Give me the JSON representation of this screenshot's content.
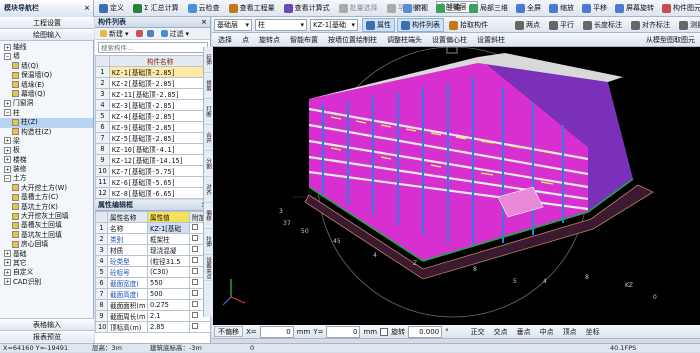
{
  "title_bar": {
    "text": "模块导航栏",
    "close": "×"
  },
  "top_toolbar": {
    "items": [
      {
        "label": "定义",
        "icon": "define-icon",
        "color": "#3c6fb0"
      },
      {
        "label": "Σ 汇总计算",
        "icon": "sum-icon",
        "color": "#2a7f3a"
      },
      {
        "label": "云检查",
        "icon": "cloud-check-icon",
        "color": "#4a90d9"
      },
      {
        "label": "查看工程量",
        "icon": "view-quantity-icon",
        "color": "#c07a1a"
      },
      {
        "label": "查看计算式",
        "icon": "view-formula-icon",
        "color": "#6b4ab0"
      },
      {
        "label": "批量选择",
        "icon": "batch-select-icon",
        "color": "#888888"
      },
      {
        "label": "平齐板顶",
        "icon": "flush-slab-icon",
        "color": "#888888"
      }
    ],
    "floor_select": "全部楼层",
    "right_items": [
      {
        "label": "俯视",
        "icon": "top-view-icon"
      },
      {
        "label": "三维",
        "icon": "3d-icon"
      },
      {
        "label": "局部三维",
        "icon": "local-3d-icon"
      },
      {
        "label": "全屏",
        "icon": "fullscreen-icon"
      },
      {
        "label": "缩放",
        "icon": "zoom-icon"
      },
      {
        "label": "平移",
        "icon": "pan-icon"
      },
      {
        "label": "屏幕旋转",
        "icon": "rotate-screen-icon"
      },
      {
        "label": "构件图元显示设置",
        "icon": "display-settings-icon"
      }
    ]
  },
  "second_toolbar": {
    "layer_select": "基础层",
    "type_select": "柱",
    "name_select": "KZ-1[基础",
    "items": [
      {
        "label": "属性",
        "icon": "property-icon"
      },
      {
        "label": "构件列表",
        "icon": "component-list-icon"
      },
      {
        "label": "拾取构件",
        "icon": "pick-component-icon"
      }
    ],
    "right_items": [
      {
        "label": "两点",
        "icon": "two-point-icon"
      },
      {
        "label": "平行",
        "icon": "parallel-icon"
      },
      {
        "label": "长度标注",
        "icon": "length-dim-icon"
      },
      {
        "label": "对齐标注",
        "icon": "align-dim-icon"
      },
      {
        "label": "测量距离",
        "icon": "measure-icon"
      }
    ]
  },
  "third_toolbar": {
    "items": [
      "选择",
      "点",
      "旋转点",
      "智能布置",
      "按墙位置绘制柱",
      "调整柱端头",
      "设置偏心柱",
      "设置斜柱"
    ],
    "right": "从模型图取图元"
  },
  "nav_panel": {
    "buttons": [
      "工程设置",
      "绘图输入"
    ],
    "tree": [
      {
        "label": "轴线",
        "indent": 1,
        "sign": "+"
      },
      {
        "label": "墙",
        "indent": 1,
        "sign": "−"
      },
      {
        "label": "墙(Q)",
        "indent": 3,
        "sign": ""
      },
      {
        "label": "保温墙(Q)",
        "indent": 3,
        "sign": ""
      },
      {
        "label": "墙垛(E)",
        "indent": 3,
        "sign": ""
      },
      {
        "label": "幕墙(Q)",
        "indent": 3,
        "sign": ""
      },
      {
        "label": "门窗洞",
        "indent": 1,
        "sign": "+"
      },
      {
        "label": "柱",
        "indent": 1,
        "sign": "−"
      },
      {
        "label": "柱(Z)",
        "indent": 3,
        "sign": "",
        "selected": true
      },
      {
        "label": "构造柱(Z)",
        "indent": 3,
        "sign": ""
      },
      {
        "label": "梁",
        "indent": 1,
        "sign": "+"
      },
      {
        "label": "板",
        "indent": 1,
        "sign": "+"
      },
      {
        "label": "楼梯",
        "indent": 1,
        "sign": "+"
      },
      {
        "label": "装修",
        "indent": 1,
        "sign": "+"
      },
      {
        "label": "土方",
        "indent": 1,
        "sign": "−"
      },
      {
        "label": "大开挖土方(W)",
        "indent": 3,
        "sign": ""
      },
      {
        "label": "基槽土方(C)",
        "indent": 3,
        "sign": ""
      },
      {
        "label": "基坑土方(K)",
        "indent": 3,
        "sign": ""
      },
      {
        "label": "大开挖灰土回填",
        "indent": 3,
        "sign": ""
      },
      {
        "label": "基槽灰土回填",
        "indent": 3,
        "sign": ""
      },
      {
        "label": "基坑灰土回填",
        "indent": 3,
        "sign": ""
      },
      {
        "label": "房心回填",
        "indent": 3,
        "sign": ""
      },
      {
        "label": "基础",
        "indent": 1,
        "sign": "+"
      },
      {
        "label": "其它",
        "indent": 1,
        "sign": "+"
      },
      {
        "label": "自定义",
        "indent": 1,
        "sign": "+"
      },
      {
        "label": "CAD识别",
        "indent": 1,
        "sign": "+"
      }
    ],
    "bottom_buttons": [
      "表格输入",
      "报表预览"
    ]
  },
  "component_list": {
    "header": "构件列表",
    "new_label": "新建",
    "filter_label": "过滤",
    "search_placeholder": "搜索构件...",
    "column": "构件名称",
    "rows": [
      "KZ-1[基础顶-2.85]",
      "KZ-2[基础顶-2.85]",
      "KZ-11[基础顶-2.85]",
      "KZ-3[基础顶-2.85]",
      "KZ-4[基础顶-2.85]",
      "KZ-9[基础顶-2.85]",
      "KZ-5[基础顶-2.85]",
      "KZ-10[基础顶-4.1]",
      "KZ-12[基础顶-14.15]",
      "KZ-7[基础顶-5.75]",
      "KZ-6[基础顶-5.65]",
      "KZ-8[基础顶-6.65]",
      "KZ-12[基础顶-14.15]-1"
    ]
  },
  "property_editor": {
    "header": "属性编辑框",
    "columns": [
      "属性名称",
      "属性值",
      "附加"
    ],
    "rows": [
      {
        "num": "1",
        "name": "名称",
        "value": "KZ-1[基础",
        "blue": false
      },
      {
        "num": "2",
        "name": "类别",
        "value": "框架柱",
        "blue": true
      },
      {
        "num": "3",
        "name": "材质",
        "value": "现浇混凝",
        "blue": false
      },
      {
        "num": "4",
        "name": "砼类型",
        "value": "(粒径31.5",
        "blue": true
      },
      {
        "num": "5",
        "name": "砼标号",
        "value": "(C30)",
        "blue": true
      },
      {
        "num": "6",
        "name": "截面宽度(",
        "value": "550",
        "blue": true
      },
      {
        "num": "7",
        "name": "截面高度(",
        "value": "500",
        "blue": true
      },
      {
        "num": "8",
        "name": "截面面积(m",
        "value": "0.275",
        "blue": false
      },
      {
        "num": "9",
        "name": "截面周长(m",
        "value": "2.1",
        "blue": false
      },
      {
        "num": "10",
        "name": "顶标高(m)",
        "value": "2.85",
        "blue": false
      }
    ]
  },
  "view_side_tools": [
    "延伸",
    "修剪",
    "打断",
    "合并",
    "分割",
    "对齐",
    "偏移",
    "拉伸",
    "设置夹点"
  ],
  "bottom_toolbar": {
    "nonoffset": "不偏移",
    "x_label": "X=",
    "x_value": "0",
    "mm1": "mm",
    "y_label": "Y=",
    "y_value": "0",
    "mm2": "mm",
    "rotate_label": "旋转",
    "rotate_value": "0.000",
    "snap_items": [
      "正交",
      "交点",
      "垂点",
      "中点",
      "顶点",
      "坐标"
    ]
  },
  "status_bar": {
    "coords": "X=64160  Y=-19491",
    "floor_height": "层高：3m",
    "bottom_elev": "建筑底标高：-3m",
    "zero": "0",
    "fps": "40.1FPS"
  }
}
